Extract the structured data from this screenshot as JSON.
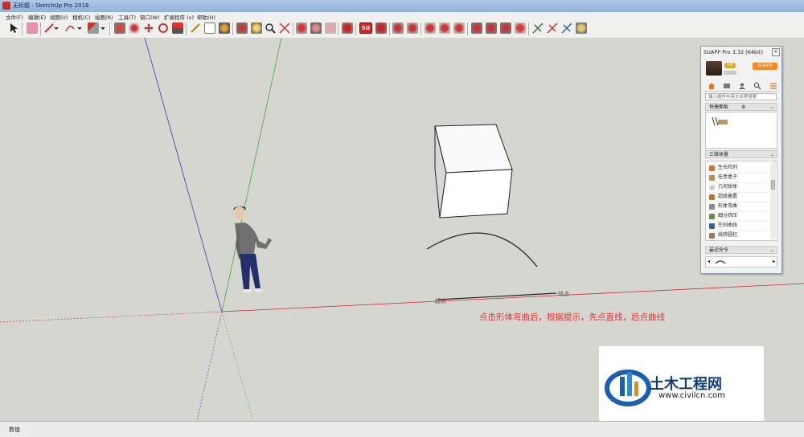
{
  "window": {
    "title": "无标题 - SketchUp Pro 2018"
  },
  "menu": [
    "文件(F)",
    "编辑(E)",
    "视图(V)",
    "相机(C)",
    "绘图(R)",
    "工具(T)",
    "窗口(W)",
    "扩展程序 (x)",
    "帮助(H)"
  ],
  "toolbar": {
    "su_label": "SU"
  },
  "suapp": {
    "title": "SUAPP Pro 3.32 (64bit)",
    "vip_badge": "VIP",
    "brand_button": "SUAPP 3.32",
    "search_placeholder": "输入插件中英文名称搜索",
    "quick_header": "快捷面板",
    "category_header": "三维体量",
    "items": [
      "生长阵列",
      "任意盒子",
      "几何球体",
      "超级叠置",
      "形体弯曲",
      "细分挤压",
      "空间曲线",
      "线转圆柱"
    ],
    "recent_header": "最近命令"
  },
  "viewport": {
    "start_label": "起点",
    "end_label": "终点",
    "hint": "点击形体弯曲后，根据提示，先点直线，后点曲线"
  },
  "status": {
    "measure_label": "数值"
  },
  "watermark": {
    "cn": "土木工程网",
    "url": "www.civilcn.com"
  },
  "colors": {
    "axis_red": "#cc2a2a",
    "axis_green": "#3fa83f",
    "axis_blue": "#3a3ab8",
    "hint_red": "#e03434",
    "watermark_blue": "#0f3a7a"
  }
}
